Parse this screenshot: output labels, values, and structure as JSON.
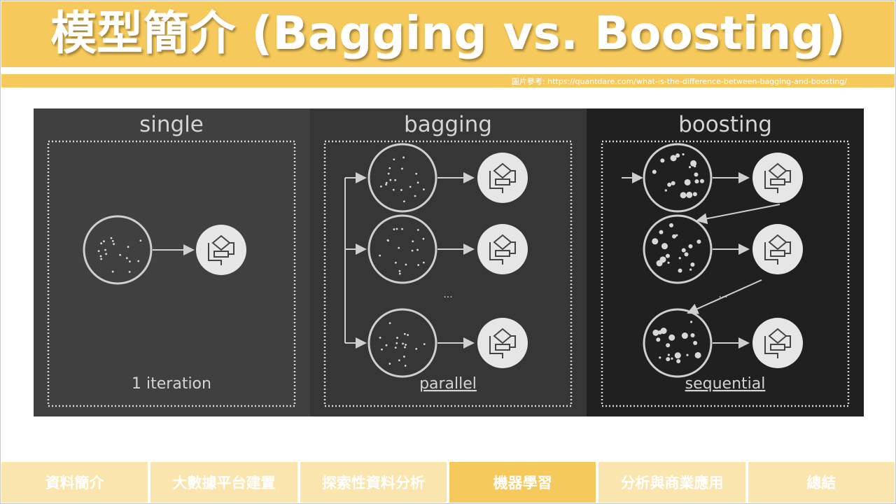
{
  "title": "模型簡介 (Bagging vs. Boosting)",
  "source_note": "圖片參考: https://quantdare.com/what-is-the-difference-between-bagging-and-boosting/",
  "figure": {
    "panels": [
      {
        "label": "single",
        "caption": "1 iteration"
      },
      {
        "label": "bagging",
        "caption": "parallel"
      },
      {
        "label": "boosting",
        "caption": "sequential"
      }
    ],
    "ellipsis": "..."
  },
  "nav": {
    "tabs": [
      {
        "label": "資料簡介"
      },
      {
        "label": "大數據平台建置"
      },
      {
        "label": "探索性資料分析"
      },
      {
        "label": "機器學習",
        "active": true
      },
      {
        "label": "分析與商業應用"
      },
      {
        "label": "總結"
      }
    ]
  }
}
